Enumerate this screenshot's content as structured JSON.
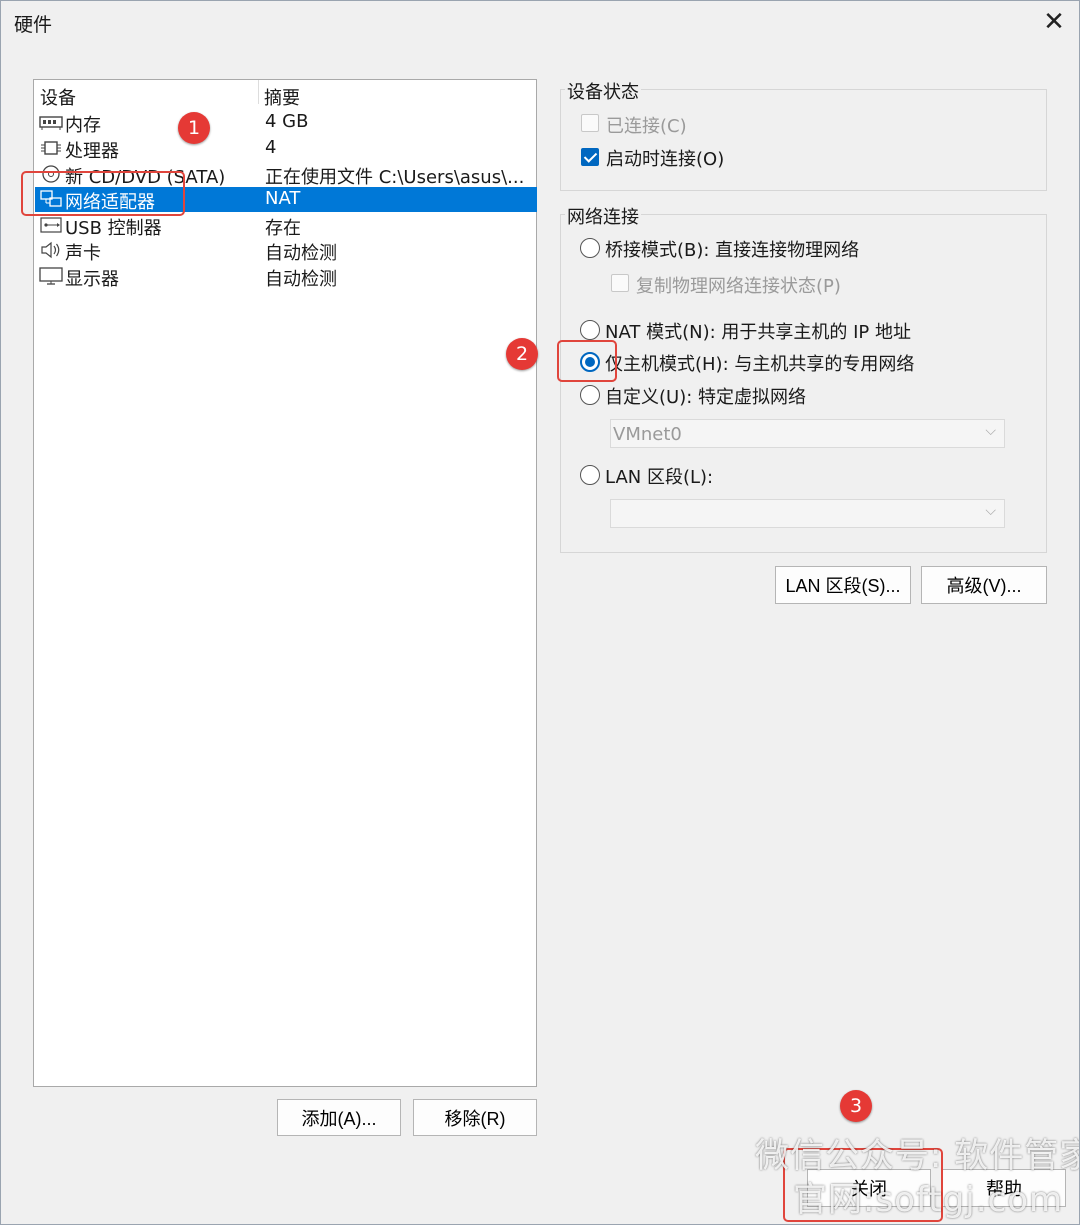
{
  "window": {
    "title": "硬件"
  },
  "device_list": {
    "columns": [
      "设备",
      "摘要"
    ],
    "rows": [
      {
        "name": "内存",
        "summary": "4 GB",
        "icon": "memory-icon"
      },
      {
        "name": "处理器",
        "summary": "4",
        "icon": "cpu-icon"
      },
      {
        "name": "新 CD/DVD (SATA)",
        "summary": "正在使用文件 C:\\Users\\asus\\...",
        "icon": "cd-dvd-icon"
      },
      {
        "name": "网络适配器",
        "summary": "NAT",
        "icon": "network-adapter-icon",
        "selected": true
      },
      {
        "name": "USB 控制器",
        "summary": "存在",
        "icon": "usb-icon"
      },
      {
        "name": "声卡",
        "summary": "自动检测",
        "icon": "speaker-icon"
      },
      {
        "name": "显示器",
        "summary": "自动检测",
        "icon": "monitor-icon"
      }
    ]
  },
  "list_buttons": {
    "add": "添加(A)...",
    "remove": "移除(R)"
  },
  "device_status": {
    "label": "设备状态",
    "connected": {
      "label": "已连接(C)",
      "checked": false,
      "enabled": false
    },
    "connect_on_start": {
      "label": "启动时连接(O)",
      "checked": true,
      "enabled": true
    }
  },
  "network": {
    "label": "网络连接",
    "bridged": {
      "label": "桥接模式(B): 直接连接物理网络",
      "selected": false
    },
    "replicate": {
      "label": "复制物理网络连接状态(P)",
      "checked": false,
      "enabled": false
    },
    "nat": {
      "label": "NAT 模式(N): 用于共享主机的 IP 地址",
      "selected": false
    },
    "host_only": {
      "label": "仅主机模式(H): 与主机共享的专用网络",
      "selected": true
    },
    "custom": {
      "label": "自定义(U): 特定虚拟网络",
      "selected": false,
      "value": "VMnet0"
    },
    "lan": {
      "label": "LAN 区段(L):",
      "selected": false,
      "value": ""
    }
  },
  "net_buttons": {
    "lan_segments": "LAN 区段(S)...",
    "advanced": "高级(V)..."
  },
  "footer_buttons": {
    "close": "关闭",
    "help": "帮助"
  },
  "annotations": {
    "step1": "1",
    "step2": "2",
    "step3": "3"
  },
  "watermark": {
    "line1": "微信公众号: 软件管家",
    "line2": "官网:softgj.com"
  },
  "colors": {
    "selection": "#0078d7",
    "accent": "#0067c0",
    "annotation": "#e0453c"
  }
}
